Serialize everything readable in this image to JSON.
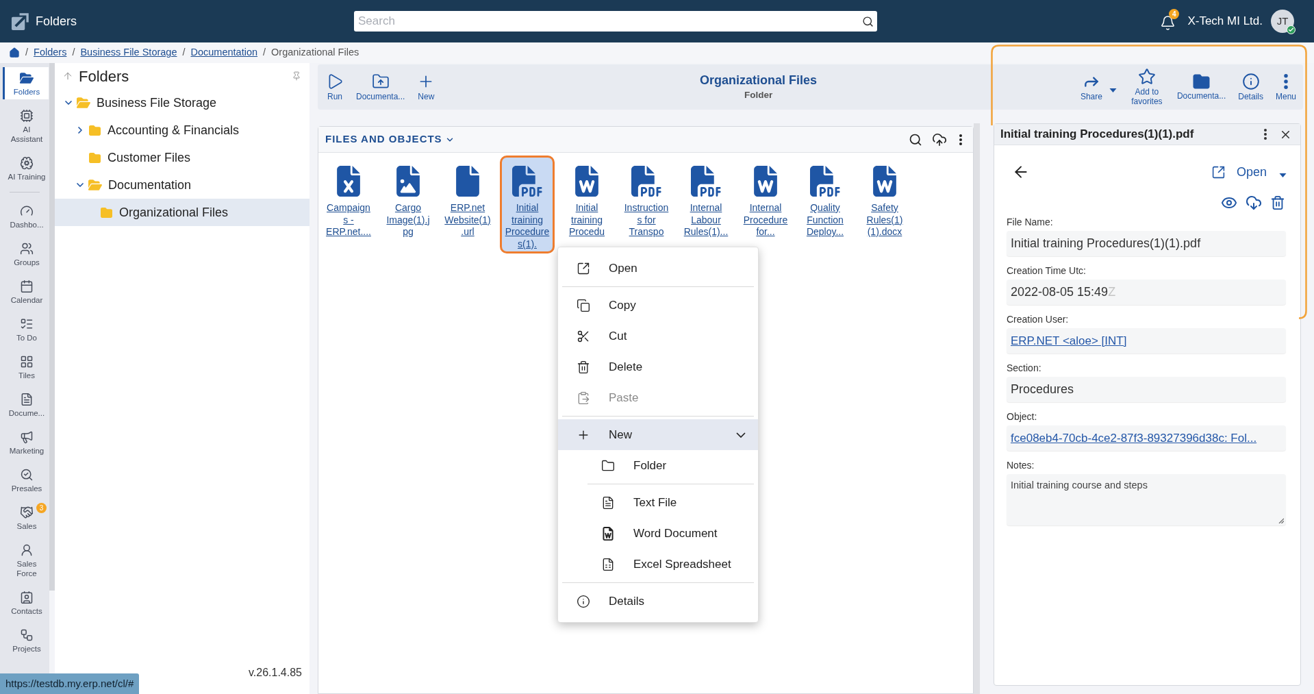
{
  "header": {
    "app_title": "Folders",
    "search": {
      "placeholder": "Search"
    },
    "notifications": {
      "count": "4"
    },
    "company": "X-Tech MI Ltd.",
    "user": {
      "initials": "JT"
    }
  },
  "breadcrumb": [
    {
      "separator": "/",
      "label": "Folders",
      "current": false
    },
    {
      "separator": "/",
      "label": "Business File Storage",
      "current": false
    },
    {
      "separator": "/",
      "label": "Documentation",
      "current": false
    },
    {
      "separator": "/",
      "label": "Organizational Files",
      "current": true
    }
  ],
  "nav": {
    "top": [
      {
        "label": "Folders",
        "selected": true
      },
      {
        "label": "AI Assistant",
        "selected": false
      },
      {
        "label": "AI Training",
        "selected": false
      }
    ],
    "main": [
      {
        "label": "Dashbo...",
        "selected": false
      },
      {
        "label": "Groups",
        "selected": false
      },
      {
        "label": "Calendar",
        "selected": false
      },
      {
        "label": "To Do",
        "selected": false
      },
      {
        "label": "Tiles",
        "selected": false
      },
      {
        "label": "Docume...",
        "selected": false
      },
      {
        "label": "Marketing",
        "selected": false
      },
      {
        "label": "Presales",
        "selected": false
      },
      {
        "label": "Sales",
        "selected": false,
        "badge": "3"
      },
      {
        "label": "Sales Force",
        "selected": false
      },
      {
        "label": "Contacts",
        "selected": false
      },
      {
        "label": "Projects",
        "selected": false
      }
    ]
  },
  "folder_tree": {
    "title": "Folders",
    "items": [
      {
        "label": "Business File Storage",
        "selected": false,
        "expanded": true,
        "children": [
          {
            "label": "Accounting & Financials",
            "selected": false,
            "expanded": false
          },
          {
            "label": "Customer Files",
            "selected": false
          },
          {
            "label": "Documentation",
            "selected": false,
            "expanded": true,
            "children": [
              {
                "label": "Organizational Files",
                "selected": true
              }
            ]
          }
        ]
      }
    ],
    "version": "v.26.1.4.85"
  },
  "status_url": "https://testdb.my.erp.net/cl/#",
  "toolbar": {
    "left": [
      {
        "label": "Run"
      },
      {
        "label": "Documenta..."
      },
      {
        "label": "New"
      }
    ],
    "title": "Organizational Files",
    "subtitle": "Folder",
    "right": [
      {
        "label": "Share",
        "dropdown": true
      },
      {
        "label": "Add to favorites"
      },
      {
        "label": "Documenta..."
      },
      {
        "label": "Details"
      },
      {
        "label": "Menu"
      }
    ]
  },
  "files_panel": {
    "title": "FILES AND OBJECTS",
    "items": [
      {
        "kind": "excel",
        "label": "Campaigns - ERP.net....",
        "selected": false
      },
      {
        "kind": "image",
        "label": "Cargo Image(1).jpg",
        "selected": false
      },
      {
        "kind": "file",
        "label": "ERP.net Website(1).url",
        "selected": false
      },
      {
        "kind": "pdf",
        "label": "Initial training Procedures(1).",
        "selected": true
      },
      {
        "kind": "word",
        "label": "Initial training Procedu",
        "selected": false
      },
      {
        "kind": "pdf",
        "label": "Instructions for Transpo",
        "selected": false
      },
      {
        "kind": "pdf",
        "label": "Internal Labour Rules(1)...",
        "selected": false
      },
      {
        "kind": "word",
        "label": "Internal Procedure for...",
        "selected": false
      },
      {
        "kind": "pdf",
        "label": "Quality Function Deploy...",
        "selected": false
      },
      {
        "kind": "word",
        "label": "Safety Rules(1)(1).docx",
        "selected": false
      }
    ]
  },
  "context_menu": {
    "groups": [
      {
        "items": [
          {
            "label": "Open",
            "disabled": false
          }
        ]
      },
      {
        "items": [
          {
            "label": "Copy",
            "disabled": false
          },
          {
            "label": "Cut",
            "disabled": false
          },
          {
            "label": "Delete",
            "disabled": false
          },
          {
            "label": "Paste",
            "disabled": true
          }
        ]
      },
      {
        "items": [
          {
            "label": "New",
            "disabled": false,
            "expanded": true,
            "submenu": [
              {
                "items": [
                  {
                    "label": "Folder",
                    "disabled": false
                  }
                ]
              },
              {
                "items": [
                  {
                    "label": "Text File",
                    "disabled": false
                  },
                  {
                    "label": "Word Document",
                    "disabled": false
                  },
                  {
                    "label": "Excel Spreadsheet",
                    "disabled": false
                  }
                ]
              }
            ]
          }
        ]
      },
      {
        "items": [
          {
            "label": "Details",
            "disabled": false
          }
        ]
      }
    ]
  },
  "details": {
    "title": "Initial training Procedures(1)(1).pdf",
    "open_label": "Open",
    "fields": [
      {
        "label": "File Name:",
        "kind": "text",
        "value": "Initial training Procedures(1)(1).pdf"
      },
      {
        "label": "Creation Time Utc:",
        "kind": "text",
        "value": "2022-08-05 15:49",
        "suffix": "Z"
      },
      {
        "label": "Creation User:",
        "kind": "link",
        "value": "ERP.NET <aloe> [INT]"
      },
      {
        "label": "Section:",
        "kind": "text",
        "value": "Procedures"
      },
      {
        "label": "Object:",
        "kind": "link",
        "value": "fce08eb4-70cb-4ce2-87f3-89327396d38c: Fol..."
      },
      {
        "label": "Notes:",
        "kind": "textarea",
        "value": "Initial training course and steps"
      }
    ]
  }
}
